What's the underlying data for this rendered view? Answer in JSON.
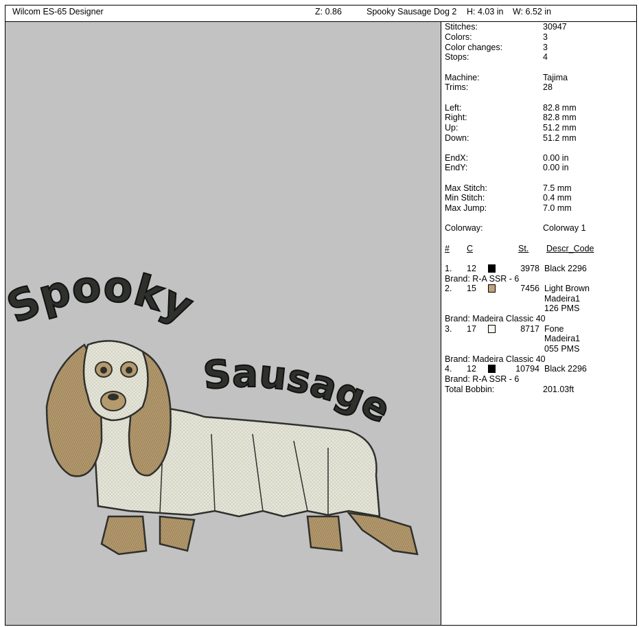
{
  "header": {
    "app_name": "Wilcom ES-65 Designer",
    "zoom": "Z: 0.86",
    "design_name": "Spooky Sausage Dog 2",
    "height": "H: 4.03 in",
    "width": "W: 6.52 in"
  },
  "design": {
    "text_line1": "Spooky",
    "text_line2": "Sausage",
    "colors": {
      "background": "#c2c2c2",
      "thread_black": "#2e302c",
      "thread_brown": "#b59a6e",
      "thread_fone": "#e9e8dc"
    }
  },
  "stats": {
    "stitches": {
      "label": "Stitches:",
      "value": "30947"
    },
    "colors": {
      "label": "Colors:",
      "value": "3"
    },
    "color_changes": {
      "label": "Color changes:",
      "value": "3"
    },
    "stops": {
      "label": "Stops:",
      "value": "4"
    },
    "machine": {
      "label": "Machine:",
      "value": "Tajima"
    },
    "trims": {
      "label": "Trims:",
      "value": "28"
    },
    "left": {
      "label": "Left:",
      "value": "82.8 mm"
    },
    "right": {
      "label": "Right:",
      "value": "82.8 mm"
    },
    "up": {
      "label": "Up:",
      "value": "51.2 mm"
    },
    "down": {
      "label": "Down:",
      "value": "51.2 mm"
    },
    "endx": {
      "label": "EndX:",
      "value": "0.00 in"
    },
    "endy": {
      "label": "EndY:",
      "value": "0.00 in"
    },
    "max_stitch": {
      "label": "Max Stitch:",
      "value": "7.5 mm"
    },
    "min_stitch": {
      "label": "Min Stitch:",
      "value": "0.4 mm"
    },
    "max_jump": {
      "label": "Max Jump:",
      "value": "7.0 mm"
    },
    "colorway": {
      "label": "Colorway:",
      "value": "Colorway 1"
    }
  },
  "thread_table": {
    "headers": {
      "num": "#",
      "c": "C",
      "st": "St.",
      "descr": "Descr_Code"
    },
    "rows": [
      {
        "num": "1.",
        "c": "12",
        "swatch": "#000000",
        "st": "3978",
        "descr": [
          "Black 2296"
        ],
        "brand": "Brand: R-A SSR - 6"
      },
      {
        "num": "2.",
        "c": "15",
        "swatch": "#c3a07e",
        "st": "7456",
        "descr": [
          "Light Brown",
          "Madeira1",
          "126 PMS"
        ],
        "brand": "Brand: Madeira Classic 40"
      },
      {
        "num": "3.",
        "c": "17",
        "swatch": "#f6f6f0",
        "st": "8717",
        "descr": [
          "Fone",
          "Madeira1",
          "055 PMS"
        ],
        "brand": "Brand: Madeira Classic 40"
      },
      {
        "num": "4.",
        "c": "12",
        "swatch": "#000000",
        "st": "10794",
        "descr": [
          "Black 2296"
        ],
        "brand": "Brand: R-A SSR - 6"
      }
    ],
    "total_bobbin": {
      "label": "Total Bobbin:",
      "value": "201.03ft"
    }
  }
}
